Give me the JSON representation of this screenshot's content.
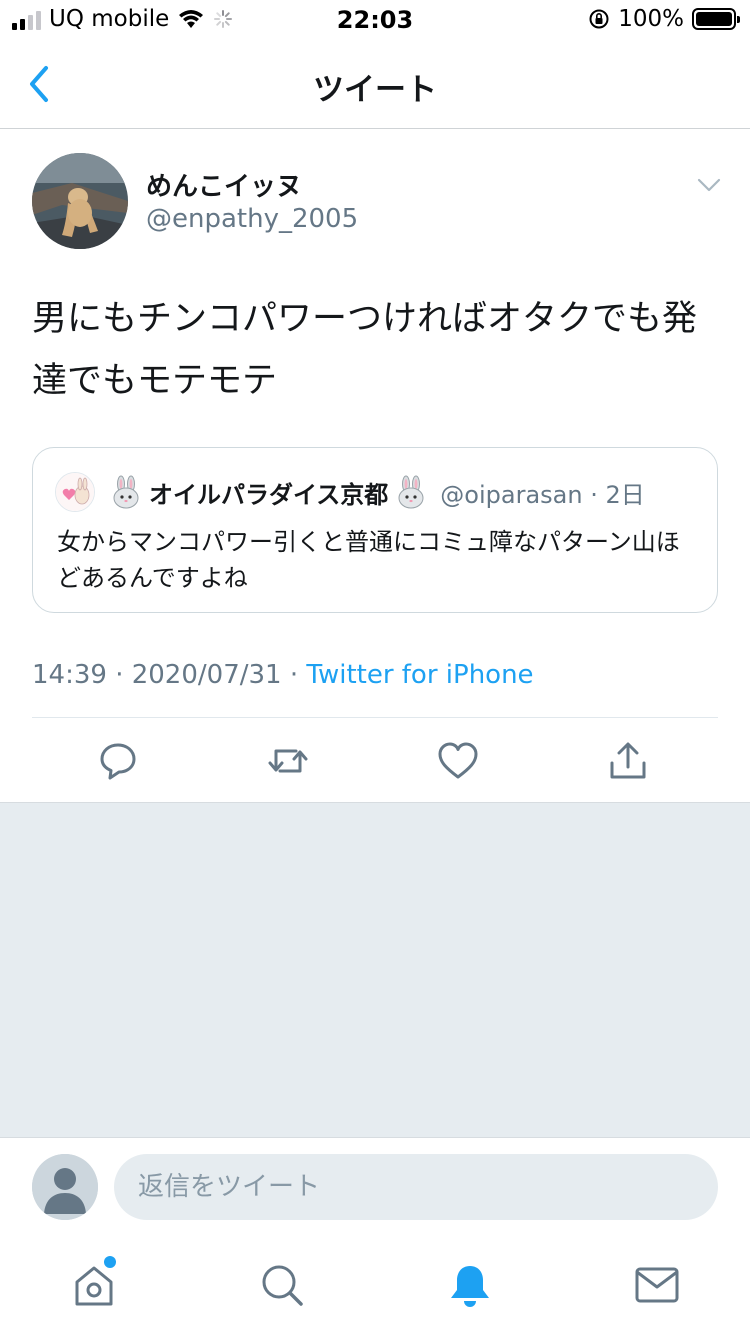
{
  "status_bar": {
    "carrier": "UQ mobile",
    "time": "22:03",
    "battery": "100%"
  },
  "nav": {
    "title": "ツイート"
  },
  "tweet": {
    "author_name": "めんこイッヌ",
    "author_handle": "@enpathy_2005",
    "text": "男にもチンコパワーつければオタクでも発達でもモテモテ",
    "timestamp": "14:39 · 2020/07/31 · ",
    "client": "Twitter for iPhone"
  },
  "quote": {
    "author_name": "オイルパラダイス京都",
    "author_handle": "@oiparasan · 2日",
    "text": "女からマンコパワー引くと普通にコミュ障なパターン山ほどあるんですよね"
  },
  "actions": [
    "reply-icon",
    "retweet-icon",
    "like-icon",
    "share-icon"
  ],
  "reply": {
    "placeholder": "返信をツイート"
  },
  "tab_bar": [
    "home-icon",
    "search-icon",
    "notifications-icon",
    "messages-icon"
  ],
  "colors": {
    "accent": "#1da1f2",
    "secondary_text": "#657786",
    "background_gray": "#e6ecf0"
  }
}
